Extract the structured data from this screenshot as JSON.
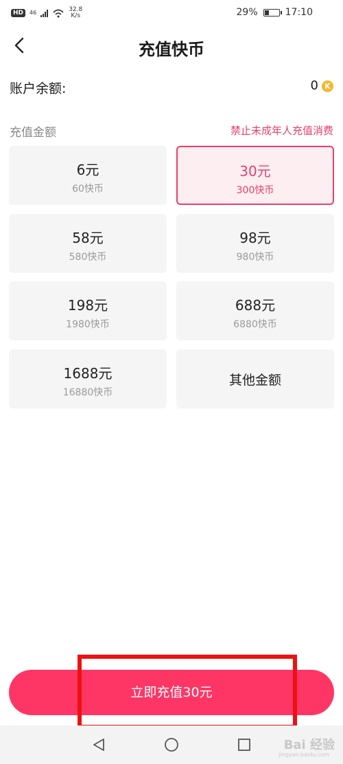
{
  "status_bar": {
    "hd": "HD",
    "network": "46",
    "speed_value": "32.8",
    "speed_unit": "K/s",
    "battery_percent": "29%",
    "battery_level": 0.29,
    "time": "17:10"
  },
  "header": {
    "title": "充值快币",
    "back_icon": "chevron-left-icon"
  },
  "balance": {
    "label": "账户余额:",
    "value": "0",
    "coin_icon": "K"
  },
  "section": {
    "label": "充值金额",
    "warning": "禁止未成年人充值消费"
  },
  "options": [
    {
      "amount": "6元",
      "coins": "60快币",
      "selected": false
    },
    {
      "amount": "30元",
      "coins": "300快币",
      "selected": true
    },
    {
      "amount": "58元",
      "coins": "580快币",
      "selected": false
    },
    {
      "amount": "98元",
      "coins": "980快币",
      "selected": false
    },
    {
      "amount": "198元",
      "coins": "1980快币",
      "selected": false
    },
    {
      "amount": "688元",
      "coins": "6880快币",
      "selected": false
    },
    {
      "amount": "1688元",
      "coins": "16880快币",
      "selected": false
    },
    {
      "amount": "其他金额",
      "coins": "",
      "selected": false
    }
  ],
  "cta": {
    "label": "立即充值30元"
  },
  "watermark": {
    "text": "Bai 经验",
    "sub": "jingyan.baidu.com"
  },
  "colors": {
    "accent": "#fe3666",
    "selected_border": "#e83e6c",
    "highlight": "#ee1111",
    "coin": "#f5b72c"
  }
}
